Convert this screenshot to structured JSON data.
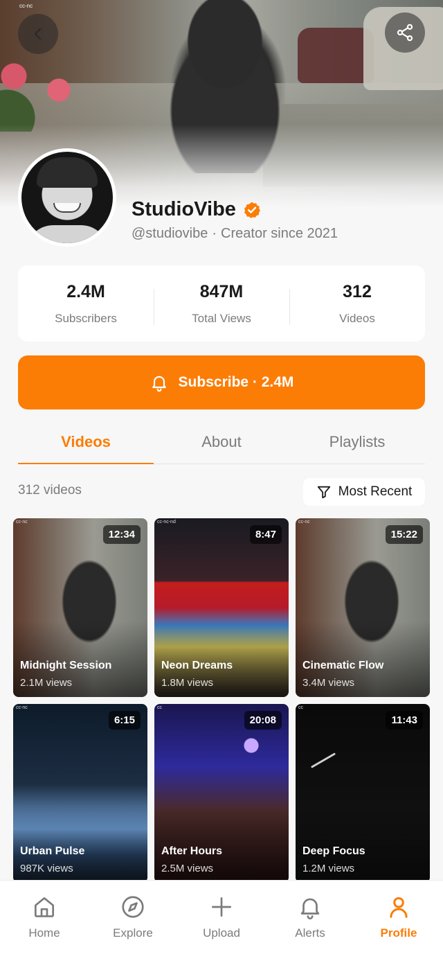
{
  "banner": {
    "watermark": "cc-nc"
  },
  "header": {
    "back_icon": "chevron-left-icon",
    "share_icon": "share-icon"
  },
  "channel": {
    "name": "StudioVibe",
    "verified_icon": "verified-badge-icon",
    "handle": "@studiovibe",
    "separator": "·",
    "since": "Creator since 2021"
  },
  "stats": [
    {
      "value": "2.4M",
      "label": "Subscribers"
    },
    {
      "value": "847M",
      "label": "Total Views"
    },
    {
      "value": "312",
      "label": "Videos"
    }
  ],
  "subscribe": {
    "label": "Subscribe · 2.4M",
    "icon": "bell-icon"
  },
  "tabs": [
    {
      "label": "Videos",
      "active": true
    },
    {
      "label": "About",
      "active": false
    },
    {
      "label": "Playlists",
      "active": false
    }
  ],
  "videos_meta": {
    "count": "312 videos",
    "sort_label": "Most Recent",
    "sort_icon": "filter-icon"
  },
  "videos": [
    {
      "title": "Midnight Session",
      "views": "2.1M views",
      "duration": "12:34",
      "cc": "cc-nc"
    },
    {
      "title": "Neon Dreams",
      "views": "1.8M views",
      "duration": "8:47",
      "cc": "cc-nc-nd"
    },
    {
      "title": "Cinematic Flow",
      "views": "3.4M views",
      "duration": "15:22",
      "cc": "cc-nc"
    },
    {
      "title": "Urban Pulse",
      "views": "987K views",
      "duration": "6:15",
      "cc": "cc-nc"
    },
    {
      "title": "After Hours",
      "views": "2.5M views",
      "duration": "20:08",
      "cc": "cc"
    },
    {
      "title": "Deep Focus",
      "views": "1.2M views",
      "duration": "11:43",
      "cc": "cc"
    }
  ],
  "nav": [
    {
      "label": "Home",
      "icon": "home-icon",
      "active": false
    },
    {
      "label": "Explore",
      "icon": "compass-icon",
      "active": false
    },
    {
      "label": "Upload",
      "icon": "plus-icon",
      "active": false
    },
    {
      "label": "Alerts",
      "icon": "bell-icon",
      "active": false
    },
    {
      "label": "Profile",
      "icon": "user-icon",
      "active": true
    }
  ],
  "colors": {
    "accent": "#fb7d06",
    "text": "#1a1a1a",
    "muted": "#7b7b7b",
    "background": "#f7f7f7"
  }
}
